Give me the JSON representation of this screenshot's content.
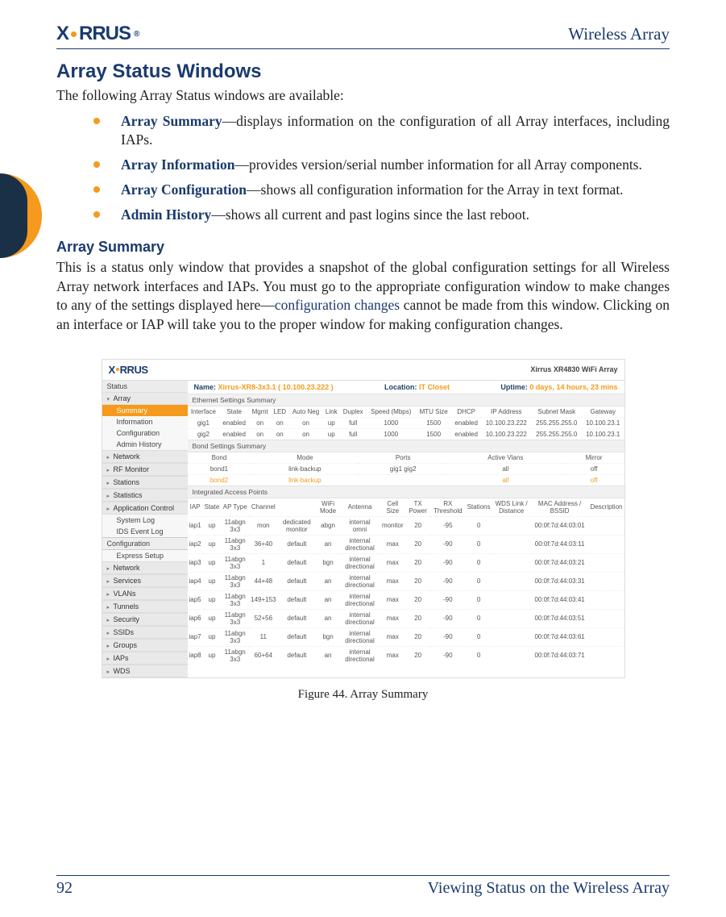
{
  "header": {
    "brand_pre": "X",
    "brand_post": "RRUS",
    "brand_tm": "®",
    "doc_title": "Wireless Array"
  },
  "section": {
    "heading": "Array Status Windows",
    "intro": "The following Array Status windows are available:",
    "bullets": [
      {
        "link": "Array Summary",
        "text": "—displays information on the configuration of all Array interfaces, including IAPs."
      },
      {
        "link": "Array Information",
        "text": "—provides version/serial number information for all Array components."
      },
      {
        "link": "Array Configuration",
        "text": "—shows all configuration information for the Array in text format."
      },
      {
        "link": "Admin History",
        "text": "—shows all current and past logins since the last reboot."
      }
    ],
    "sub_heading": "Array Summary",
    "sub_body_a": "This is a status only window that provides a snapshot of the global configuration settings for all Wireless Array network interfaces and IAPs. You must go to the appropriate configuration window to make changes to any of the settings displayed here—",
    "sub_body_link": "configuration changes",
    "sub_body_b": " cannot be made from this window. Clicking on an interface or IAP will take you to the proper window for making configuration changes."
  },
  "figure": {
    "caption": "Figure 44. Array Summary",
    "topbar": {
      "product": "Xirrus XR4830 WiFi Array",
      "name_label": "Name:",
      "name_value": "Xirrus-XR8-3x3.1   ( 10.100.23.222 )",
      "loc_label": "Location:",
      "loc_value": "IT Closet",
      "up_label": "Uptime:",
      "up_value": "0 days, 14 hours, 23 mins"
    },
    "sidebar": {
      "status": "Status",
      "array": "Array",
      "items": [
        "Summary",
        "Information",
        "Configuration",
        "Admin History"
      ],
      "groups": [
        "Network",
        "RF Monitor",
        "Stations",
        "Statistics",
        "Application Control"
      ],
      "plain": [
        "System Log",
        "IDS Event Log"
      ],
      "config": "Configuration",
      "config_groups": [
        "Express Setup",
        "Network",
        "Services",
        "VLANs",
        "Tunnels",
        "Security",
        "SSIDs",
        "Groups",
        "IAPs",
        "WDS"
      ]
    },
    "ethernet": {
      "title": "Ethernet Settings Summary",
      "headers": [
        "Interface",
        "State",
        "Mgmt",
        "LED",
        "Auto Neg",
        "Link",
        "Duplex",
        "Speed (Mbps)",
        "MTU Size",
        "DHCP",
        "IP Address",
        "Subnet Mask",
        "Gateway"
      ],
      "rows": [
        [
          "gig1",
          "enabled",
          "on",
          "on",
          "on",
          "up",
          "full",
          "1000",
          "1500",
          "enabled",
          "10.100.23.222",
          "255.255.255.0",
          "10.100.23.1"
        ],
        [
          "gig2",
          "enabled",
          "on",
          "on",
          "on",
          "up",
          "full",
          "1000",
          "1500",
          "enabled",
          "10.100.23.222",
          "255.255.255.0",
          "10.100.23.1"
        ]
      ]
    },
    "bond": {
      "title": "Bond Settings Summary",
      "headers": [
        "Bond",
        "Mode",
        "Ports",
        "Active Vlans",
        "Mirror"
      ],
      "rows": [
        [
          "bond1",
          "link-backup",
          "gig1 gig2",
          "all",
          "off"
        ],
        [
          "bond2",
          "link-backup",
          "",
          "all",
          "off"
        ]
      ]
    },
    "iap": {
      "title": "Integrated Access Points",
      "headers": [
        "IAP",
        "State",
        "AP Type",
        "Channel",
        "",
        "WiFi Mode",
        "Antenna",
        "Cell Size",
        "TX Power",
        "RX Threshold",
        "Stations",
        "WDS Link / Distance",
        "MAC Address / BSSID",
        "Description"
      ],
      "rows": [
        [
          "iap1",
          "up",
          "11abgn 3x3",
          "mon",
          "dedicated monitor",
          "abgn",
          "internal omni",
          "monitor",
          "20",
          "-95",
          "0",
          "",
          "00:0f:7d:44:03:01",
          ""
        ],
        [
          "iap2",
          "up",
          "11abgn 3x3",
          "36+40",
          "default",
          "an",
          "internal directional",
          "max",
          "20",
          "-90",
          "0",
          "",
          "00:0f:7d:44:03:11",
          ""
        ],
        [
          "iap3",
          "up",
          "11abgn 3x3",
          "1",
          "default",
          "bgn",
          "internal directional",
          "max",
          "20",
          "-90",
          "0",
          "",
          "00:0f:7d:44:03:21",
          ""
        ],
        [
          "iap4",
          "up",
          "11abgn 3x3",
          "44+48",
          "default",
          "an",
          "internal directional",
          "max",
          "20",
          "-90",
          "0",
          "",
          "00:0f:7d:44:03:31",
          ""
        ],
        [
          "iap5",
          "up",
          "11abgn 3x3",
          "149+153",
          "default",
          "an",
          "internal directional",
          "max",
          "20",
          "-90",
          "0",
          "",
          "00:0f:7d:44:03:41",
          ""
        ],
        [
          "iap6",
          "up",
          "11abgn 3x3",
          "52+56",
          "default",
          "an",
          "internal directional",
          "max",
          "20",
          "-90",
          "0",
          "",
          "00:0f:7d:44:03:51",
          ""
        ],
        [
          "iap7",
          "up",
          "11abgn 3x3",
          "11",
          "default",
          "bgn",
          "internal directional",
          "max",
          "20",
          "-90",
          "0",
          "",
          "00:0f:7d:44:03:61",
          ""
        ],
        [
          "iap8",
          "up",
          "11abgn 3x3",
          "60+64",
          "default",
          "an",
          "internal directional",
          "max",
          "20",
          "-90",
          "0",
          "",
          "00:0f:7d:44:03:71",
          ""
        ]
      ]
    }
  },
  "footer": {
    "page": "92",
    "title": "Viewing Status on the Wireless Array"
  }
}
